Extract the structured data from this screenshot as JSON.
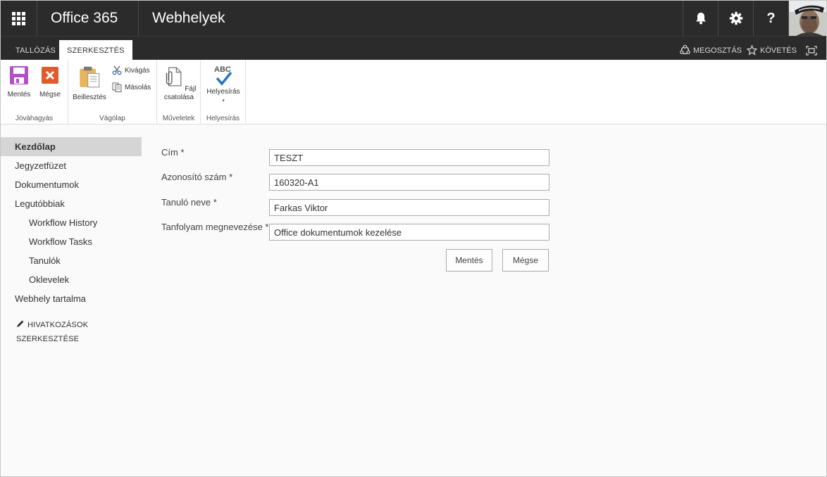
{
  "suite": {
    "brand": "Office 365",
    "site_title": "Webhelyek",
    "help_label": "?"
  },
  "tabs": [
    {
      "label": "TALLÓZÁS"
    },
    {
      "label": "SZERKESZTÉS",
      "active": true
    }
  ],
  "tab_actions": {
    "share": "MEGOSZTÁS",
    "follow": "KÖVETÉS"
  },
  "ribbon": {
    "groups": [
      {
        "label": "Jóváhagyás",
        "buttons": [
          "Mentés",
          "Mégse"
        ]
      },
      {
        "label": "Vágólap",
        "buttons": [
          "Beillesztés",
          "Kivágás",
          "Másolás"
        ]
      },
      {
        "label": "Műveletek",
        "buttons": [
          "Fájl",
          "csatolása"
        ]
      },
      {
        "label": "Helyesírás",
        "buttons": [
          "Helyesírás"
        ],
        "icon_text": "ABC"
      }
    ]
  },
  "nav": {
    "items": [
      {
        "label": "Kezdőlap"
      },
      {
        "label": "Jegyzetfüzet"
      },
      {
        "label": "Dokumentumok"
      },
      {
        "label": "Legutóbbiak"
      },
      {
        "label": "Workflow History"
      },
      {
        "label": "Workflow Tasks"
      },
      {
        "label": "Tanulók"
      },
      {
        "label": "Oklevelek"
      },
      {
        "label": "Webhely tartalma"
      }
    ],
    "edit_links_1": "HIVATKOZÁSOK",
    "edit_links_2": "SZERKESZTÉSE"
  },
  "form": {
    "fields": [
      {
        "label": "Cím *",
        "value": "TESZT"
      },
      {
        "label": "Azonosító szám *",
        "value": "160320-A1"
      },
      {
        "label": "Tanuló neve *",
        "value": "Farkas Viktor"
      },
      {
        "label": "Tanfolyam megnevezése *",
        "value": "Office dokumentumok kezelése"
      }
    ],
    "save": "Mentés",
    "cancel": "Mégse"
  },
  "colors": {
    "suitebar": "#2b2b2b",
    "accent_save": "#b34fc8",
    "accent_cancel": "#e05a2b",
    "check": "#2a74c2"
  }
}
